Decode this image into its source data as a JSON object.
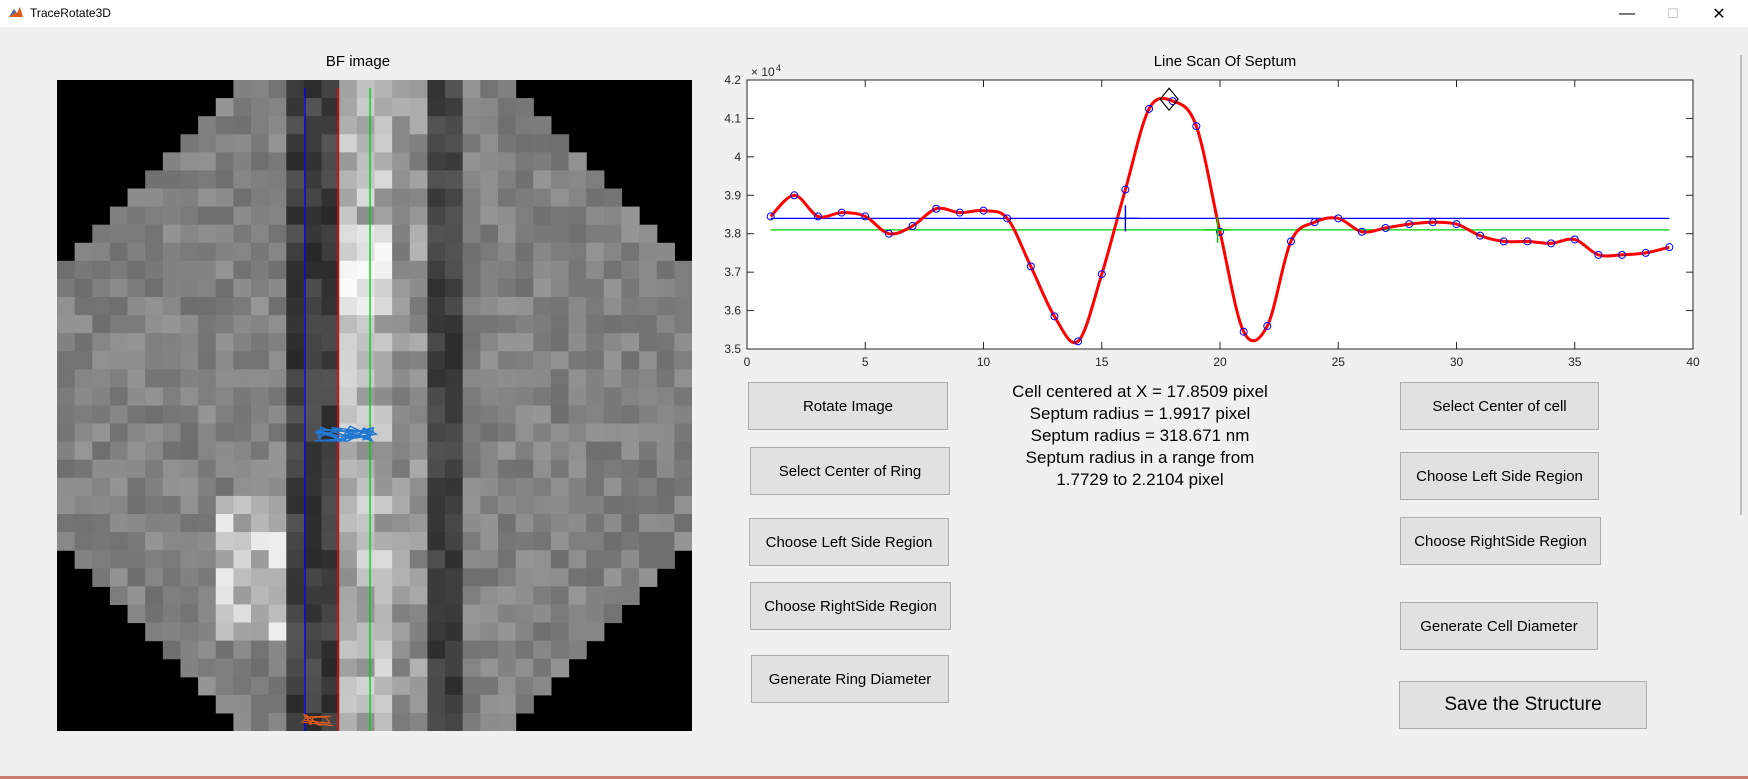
{
  "window": {
    "title": "TraceRotate3D",
    "controls": {
      "minimize": "—",
      "maximize": "☐",
      "close": "✕"
    }
  },
  "bf_panel": {
    "title": "BF image"
  },
  "plot": {
    "title": "Line Scan Of Septum",
    "exponent_label": "× 10",
    "exponent_power": "4"
  },
  "chart_data": {
    "type": "line",
    "title": "Line Scan Of Septum",
    "xlim": [
      0,
      40
    ],
    "ylim": [
      3.5,
      4.2
    ],
    "y_multiplier": "x10^4",
    "x_ticks": [
      0,
      5,
      10,
      15,
      20,
      25,
      30,
      35,
      40
    ],
    "y_ticks": [
      3.5,
      3.6,
      3.7,
      3.8,
      3.9,
      4.0,
      4.1,
      4.2
    ],
    "x_tick_labels": [
      "0",
      "5",
      "10",
      "15",
      "20",
      "25",
      "30",
      "35",
      "40"
    ],
    "y_tick_labels": [
      "3.5",
      "3.6",
      "3.7",
      "3.8",
      "3.9",
      "4",
      "4.1",
      "4.2"
    ],
    "series": [
      {
        "x": [
          1,
          2,
          3,
          4,
          5,
          6,
          7,
          8,
          9,
          10,
          11,
          12,
          13,
          14,
          15,
          16,
          17,
          18,
          19,
          20,
          21,
          22,
          23,
          24,
          25,
          26,
          27,
          28,
          29,
          30,
          31,
          32,
          33,
          34,
          35,
          36,
          37,
          38,
          39
        ],
        "values": [
          3.845,
          3.9,
          3.845,
          3.855,
          3.845,
          3.8,
          3.82,
          3.865,
          3.855,
          3.86,
          3.84,
          3.715,
          3.585,
          3.52,
          3.695,
          3.915,
          4.125,
          4.145,
          4.08,
          3.805,
          3.545,
          3.56,
          3.78,
          3.83,
          3.84,
          3.805,
          3.815,
          3.825,
          3.83,
          3.825,
          3.795,
          3.78,
          3.78,
          3.775,
          3.785,
          3.745,
          3.745,
          3.75,
          3.765
        ],
        "color": "#ff0000",
        "marker_color": "#0000ff"
      }
    ],
    "hlines": [
      {
        "y": 3.84,
        "color": "#0000ff"
      },
      {
        "y": 3.81,
        "color": "#00cc00"
      }
    ],
    "markers": [
      {
        "type": "diamond",
        "x": 17.85,
        "y": 4.15,
        "color": "#000000"
      },
      {
        "type": "cross",
        "x": 16.0,
        "y": 3.84,
        "color": "#0000ff"
      },
      {
        "type": "cross",
        "x": 19.9,
        "y": 3.81,
        "color": "#00cc00"
      }
    ]
  },
  "left_buttons": [
    "Rotate Image",
    "Select Center of Ring",
    "Choose Left Side Region",
    "Choose RightSide Region",
    "Generate Ring Diameter"
  ],
  "right_buttons": [
    "Select Center of cell",
    "Choose Left Side Region",
    "Choose RightSide Region",
    "Generate Cell Diameter",
    "Save the Structure"
  ],
  "info": {
    "line1": "Cell centered at X = 17.8509 pixel",
    "line2": "Septum radius = 1.9917 pixel",
    "line3": "Septum radius = 318.671 nm",
    "line4": "Septum radius in a range from",
    "line5": "1.7729 to 2.2104 pixel"
  },
  "colors": {
    "background": "#f0f0f0",
    "button": "#e1e1e1",
    "button_border": "#adadad",
    "line_left": "#0000ff",
    "line_center": "#ff0000",
    "line_right": "#00cc00",
    "trace": "#1f77d0"
  }
}
